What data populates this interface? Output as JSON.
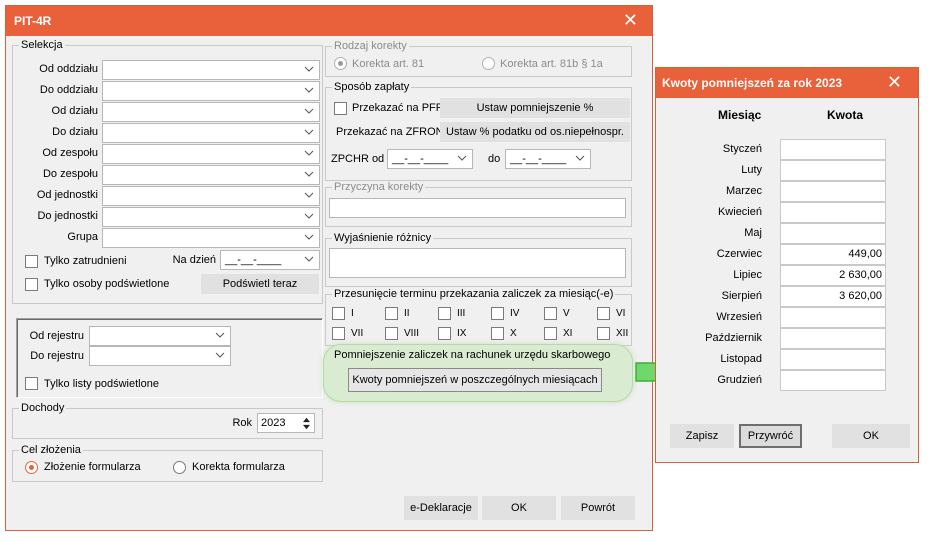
{
  "main": {
    "title": "PIT-4R",
    "selekcja": {
      "legend": "Selekcja",
      "labels": [
        "Od oddziału",
        "Do oddziału",
        "Od działu",
        "Do działu",
        "Od zespołu",
        "Do zespołu",
        "Od jednostki",
        "Do jednostki",
        "Grupa"
      ],
      "tylko_zatrudnieni": "Tylko zatrudnieni",
      "na_dzien_label": "Na dzień",
      "na_dzien_value": "__-__-____",
      "tylko_podswietlone": "Tylko osoby podświetlone",
      "podswietl_button": "Podświetl teraz"
    },
    "rejestr": {
      "od_label": "Od rejestru",
      "do_label": "Do rejestru",
      "tylko_listy": "Tylko listy podświetlone"
    },
    "dochody": {
      "legend": "Dochody",
      "rok_label": "Rok",
      "rok_value": "2023"
    },
    "cel": {
      "legend": "Cel złożenia",
      "zlozenie": "Złożenie formularza",
      "korekta": "Korekta formularza"
    },
    "rodzaj_korekty": {
      "legend": "Rodzaj korekty",
      "opt1": "Korekta art. 81",
      "opt2": "Korekta art. 81b § 1a"
    },
    "sposob_zaplaty": {
      "legend": "Sposób zapłaty",
      "pfron_label": "Przekazać na PFRON",
      "pfron_button": "Ustaw pomniejszenie %",
      "zfron_label": "Przekazać na ZFRON",
      "zfron_button": "Ustaw % podatku od os.niepełnospr.",
      "zpchr_label": "ZPCHR od",
      "zpchr_from": "__-__-____",
      "do_label": "do",
      "zpchr_to": "__-__-____"
    },
    "przyczyna": {
      "legend": "Przyczyna korekty"
    },
    "wyjasnienie": {
      "legend": "Wyjaśnienie różnicy"
    },
    "przesuniecie": {
      "legend": "Przesunięcie terminu przekazania zaliczek za miesiąc(-e)",
      "months": [
        "I",
        "II",
        "III",
        "IV",
        "V",
        "VI",
        "VII",
        "VIII",
        "IX",
        "X",
        "XI",
        "XII"
      ]
    },
    "pomniejszenie": {
      "legend": "Pomniejszenie zaliczek na rachunek urzędu skarbowego",
      "button": "Kwoty pomniejszeń w poszczególnych miesiącach"
    },
    "footer": {
      "edeklaracje": "e-Deklaracje",
      "ok": "OK",
      "powrot": "Powrót"
    }
  },
  "kwoty": {
    "title": "Kwoty pomniejszeń za rok 2023",
    "col_miesiac": "Miesiąc",
    "col_kwota": "Kwota",
    "rows": [
      {
        "month": "Styczeń",
        "amount": ""
      },
      {
        "month": "Luty",
        "amount": ""
      },
      {
        "month": "Marzec",
        "amount": ""
      },
      {
        "month": "Kwiecień",
        "amount": ""
      },
      {
        "month": "Maj",
        "amount": ""
      },
      {
        "month": "Czerwiec",
        "amount": "449,00"
      },
      {
        "month": "Lipiec",
        "amount": "2 630,00"
      },
      {
        "month": "Sierpień",
        "amount": "3 620,00"
      },
      {
        "month": "Wrzesień",
        "amount": ""
      },
      {
        "month": "Październik",
        "amount": ""
      },
      {
        "month": "Listopad",
        "amount": ""
      },
      {
        "month": "Grudzień",
        "amount": ""
      }
    ],
    "zapisz": "Zapisz",
    "przywroc": "Przywróć",
    "ok": "OK"
  },
  "colors": {
    "accent": "#e8613b",
    "arrow": "#6fd86a",
    "highlight": "#d9ecd2"
  },
  "icons": {
    "close": "close-icon",
    "dropdown": "chevron-down-icon",
    "arrow": "arrow-right-icon"
  }
}
